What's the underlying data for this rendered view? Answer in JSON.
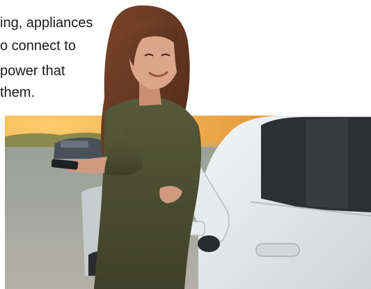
{
  "caption": {
    "lines": [
      "ing, appliances",
      "o connect to",
      "power that",
      "them."
    ]
  },
  "photo": {
    "subject": "woman holding phone leaning on white electric car while it charges",
    "colors": {
      "sunset": "#e69a37",
      "car_body": "#e9ecef",
      "dress": "#4f5330",
      "charging_cable": "#c4de3a",
      "hair": "#6b3a22"
    }
  }
}
